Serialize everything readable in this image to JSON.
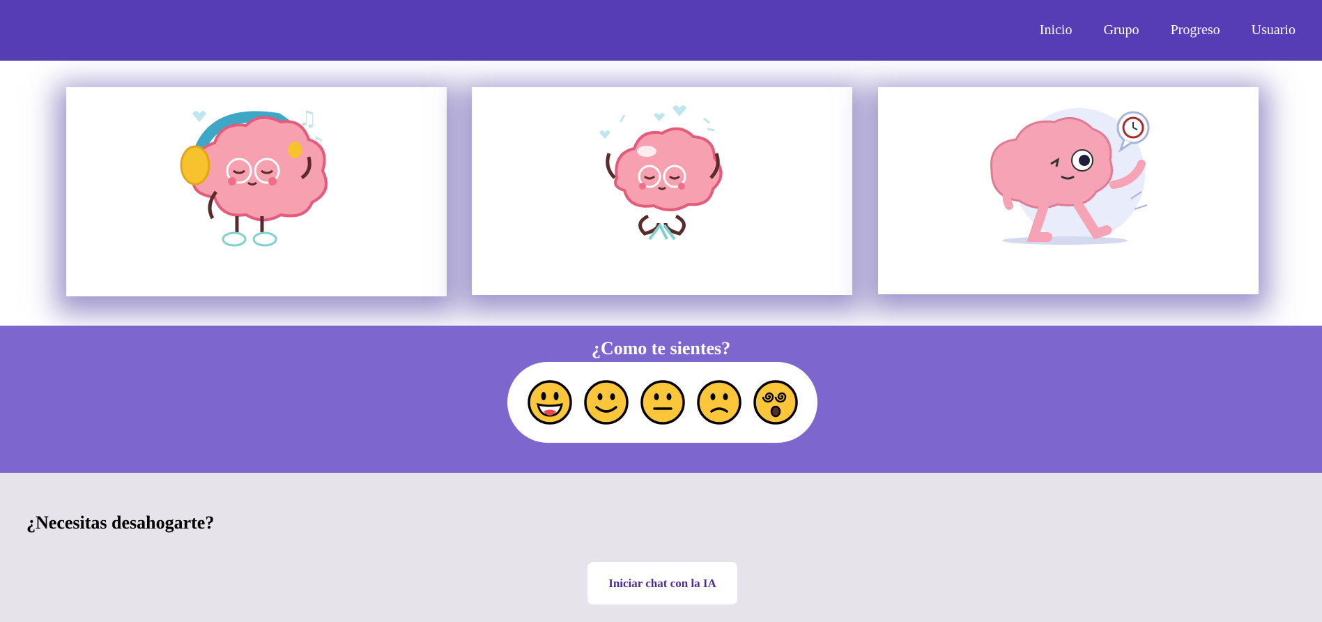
{
  "nav": {
    "items": [
      {
        "label": "Inicio"
      },
      {
        "label": "Grupo"
      },
      {
        "label": "Progreso"
      },
      {
        "label": "Usuario"
      }
    ]
  },
  "cards": [
    {
      "illustration": "brain-listening-music"
    },
    {
      "illustration": "brain-meditating"
    },
    {
      "illustration": "brain-running-late"
    }
  ],
  "mood": {
    "title": "¿Como te sientes?",
    "options": [
      {
        "icon": "grinning-face-icon"
      },
      {
        "icon": "smiling-face-icon"
      },
      {
        "icon": "neutral-face-icon"
      },
      {
        "icon": "sad-face-icon"
      },
      {
        "icon": "dizzy-face-icon"
      }
    ]
  },
  "vent": {
    "title": "¿Necesitas desahogarte?",
    "button_label": "Iniciar chat con la IA"
  },
  "colors": {
    "header": "#563db5",
    "mood_bg": "#7e66cf",
    "vent_bg": "#e6e3eb",
    "emoji_yellow": "#fcc63b",
    "brain_pink": "#f7a0b0"
  }
}
